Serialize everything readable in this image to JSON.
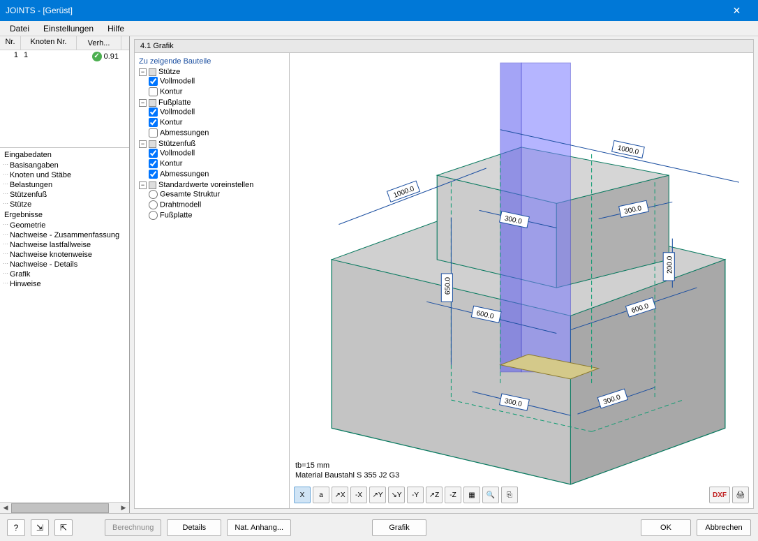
{
  "title": "JOINTS - [Gerüst]",
  "menu": {
    "file": "Datei",
    "settings": "Einstellungen",
    "help": "Hilfe"
  },
  "table": {
    "headers": {
      "nr": "Nr.",
      "knoten": "Knoten Nr.",
      "verh": "Verh..."
    },
    "row": {
      "nr": "1",
      "knoten": "1",
      "verh": "0.91"
    }
  },
  "nav": {
    "group1": "Eingabedaten",
    "g1": {
      "a": "Basisangaben",
      "b": "Knoten und Stäbe",
      "c": "Belastungen",
      "d": "Stützenfuß",
      "e": "Stütze"
    },
    "group2": "Ergebnisse",
    "g2": {
      "a": "Geometrie",
      "b": "Nachweise - Zusammenfassung",
      "c": "Nachweise lastfallweise",
      "d": "Nachweise knotenweise",
      "e": "Nachweise - Details",
      "f": "Grafik",
      "g": "Hinweise"
    }
  },
  "section_header": "4.1 Grafik",
  "tree": {
    "title": "Zu zeigende Bauteile",
    "n1": "Stütze",
    "n1a": "Vollmodell",
    "n1b": "Kontur",
    "n2": "Fußplatte",
    "n2a": "Vollmodell",
    "n2b": "Kontur",
    "n2c": "Abmessungen",
    "n3": "Stützenfuß",
    "n3a": "Vollmodell",
    "n3b": "Kontur",
    "n3c": "Abmessungen",
    "n4": "Standardwerte voreinstellen",
    "n4a": "Gesamte Struktur",
    "n4b": "Drahtmodell",
    "n4c": "Fußplatte"
  },
  "dims": {
    "d1000a": "1000.0",
    "d1000b": "1000.0",
    "d300a": "300.0",
    "d300b": "300.0",
    "d300c": "300.0",
    "d300d": "300.0",
    "d600a": "600.0",
    "d600b": "600.0",
    "d650": "650.0",
    "d200": "200.0"
  },
  "info": {
    "line1": "tb=15 mm",
    "line2": "Material Baustahl S 355 J2 G3"
  },
  "vpbtn": {
    "b1": "X",
    "b2": "a",
    "b3": "↗X",
    "b4": "-X",
    "b5": "↗Y",
    "b6": "↘Y",
    "b7": "-Y",
    "b8": "↗Z",
    "b9": "-Z",
    "b10": "▦",
    "b11": "🔍",
    "b12": "⎘",
    "dxf": "DXF",
    "print": "🖨"
  },
  "buttons": {
    "berechnung": "Berechnung",
    "details": "Details",
    "anhang": "Nat. Anhang...",
    "grafik": "Grafik",
    "ok": "OK",
    "abbrechen": "Abbrechen"
  }
}
